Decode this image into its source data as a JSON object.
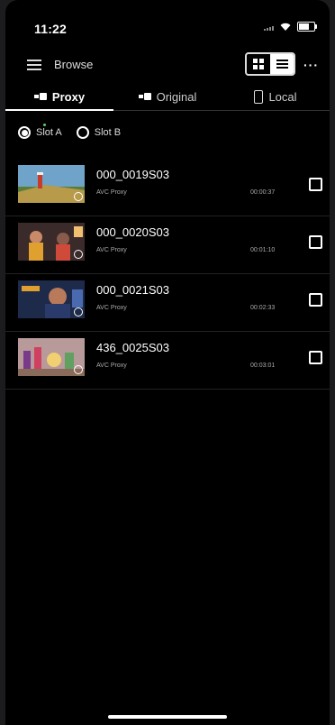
{
  "status_bar": {
    "time": "11:22"
  },
  "toolbar": {
    "title": "Browse",
    "more_label": "···"
  },
  "tabs": [
    {
      "label": "Proxy",
      "icon": "camera-icon",
      "active": true
    },
    {
      "label": "Original",
      "icon": "camera-icon",
      "active": false
    },
    {
      "label": "Local",
      "icon": "phone-icon",
      "active": false
    }
  ],
  "slots": [
    {
      "label": "Slot A",
      "selected": true
    },
    {
      "label": "Slot B",
      "selected": false
    }
  ],
  "clips": [
    {
      "name": "000_0019S03",
      "type": "AVC Proxy",
      "duration": "00:00:37",
      "checked": false
    },
    {
      "name": "000_0020S03",
      "type": "AVC Proxy",
      "duration": "00:01:10",
      "checked": false
    },
    {
      "name": "000_0021S03",
      "type": "AVC Proxy",
      "duration": "00:02:33",
      "checked": false
    },
    {
      "name": "436_0025S03",
      "type": "AVC Proxy",
      "duration": "00:03:01",
      "checked": false
    }
  ],
  "colors": {
    "background": "#000000",
    "accent": "#ffffff",
    "slot_indicator": "#5ad15a"
  }
}
